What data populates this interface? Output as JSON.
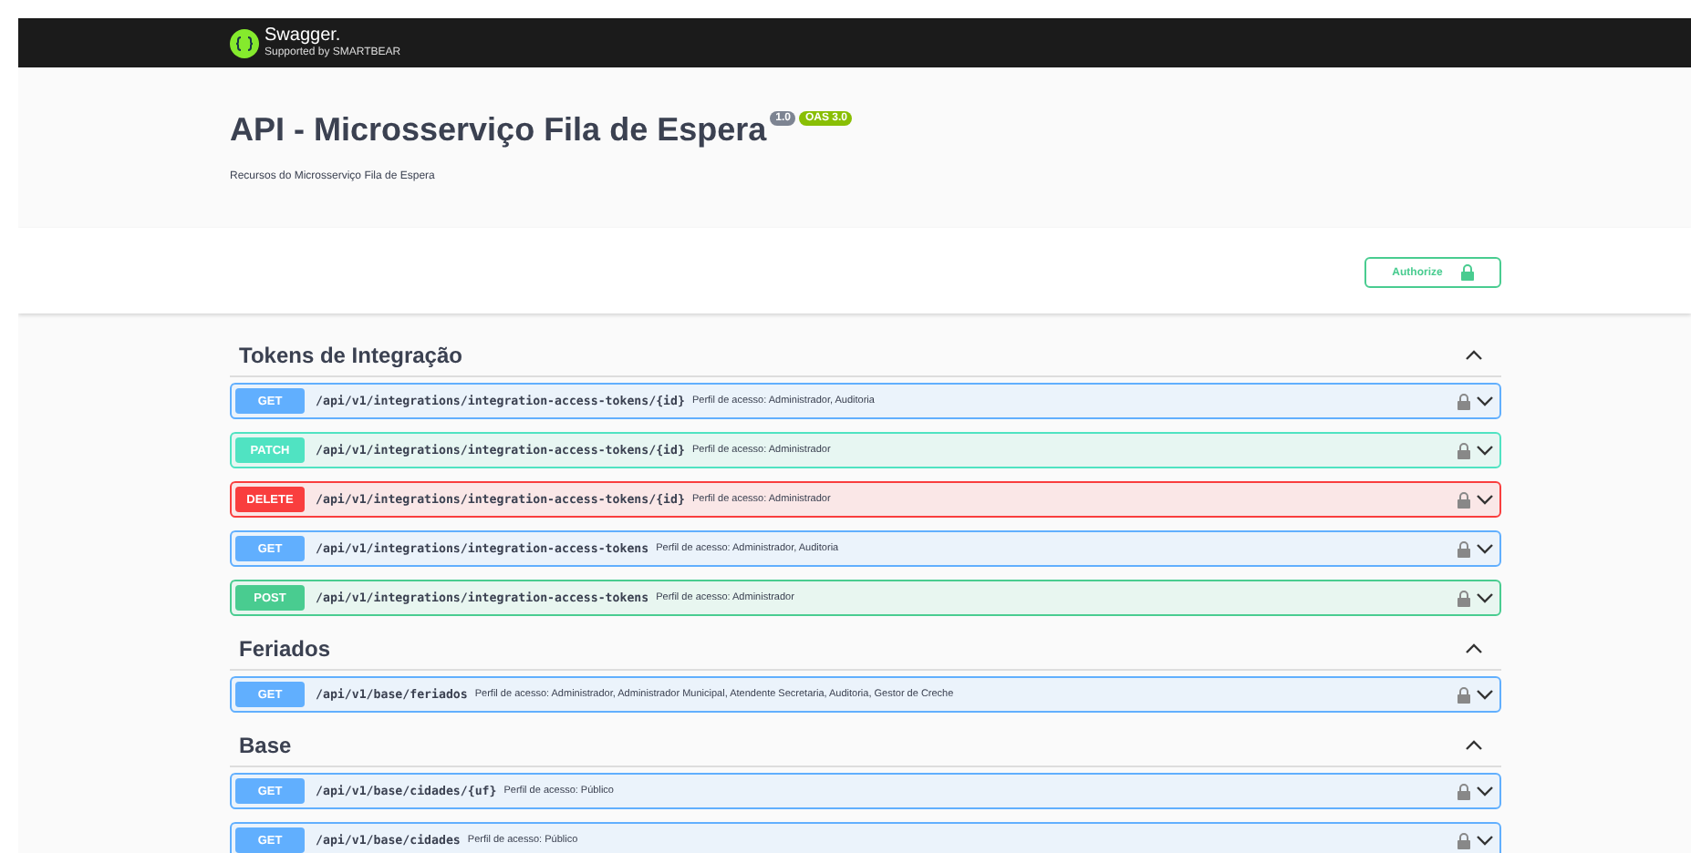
{
  "topbar": {
    "logo_text": "Swagger.",
    "logo_subtext": "Supported by SMARTBEAR"
  },
  "info": {
    "title": "API - Microsserviço Fila de Espera",
    "version": "1.0",
    "oas": "OAS 3.0",
    "description": "Recursos do Microsserviço Fila de Espera"
  },
  "authorize_button": {
    "label": "Authorize"
  },
  "tags": [
    {
      "name": "Tokens de Integração",
      "expanded": true,
      "operations": [
        {
          "kind": "get",
          "method": "GET",
          "path": "/api/v1/integrations/integration-access-tokens/{id}",
          "summary": "Perfil de acesso: Administrador, Auditoria"
        },
        {
          "kind": "patch",
          "method": "PATCH",
          "path": "/api/v1/integrations/integration-access-tokens/{id}",
          "summary": "Perfil de acesso: Administrador"
        },
        {
          "kind": "delete",
          "method": "DELETE",
          "path": "/api/v1/integrations/integration-access-tokens/{id}",
          "summary": "Perfil de acesso: Administrador"
        },
        {
          "kind": "get",
          "method": "GET",
          "path": "/api/v1/integrations/integration-access-tokens",
          "summary": "Perfil de acesso: Administrador, Auditoria"
        },
        {
          "kind": "post",
          "method": "POST",
          "path": "/api/v1/integrations/integration-access-tokens",
          "summary": "Perfil de acesso: Administrador"
        }
      ]
    },
    {
      "name": "Feriados",
      "expanded": true,
      "operations": [
        {
          "kind": "get",
          "method": "GET",
          "path": "/api/v1/base/feriados",
          "summary": "Perfil de acesso: Administrador, Administrador Municipal, Atendente Secretaria, Auditoria, Gestor de Creche"
        }
      ]
    },
    {
      "name": "Base",
      "expanded": true,
      "operations": [
        {
          "kind": "get",
          "method": "GET",
          "path": "/api/v1/base/cidades/{uf}",
          "summary": "Perfil de acesso: Público"
        },
        {
          "kind": "get",
          "method": "GET",
          "path": "/api/v1/base/cidades",
          "summary": "Perfil de acesso: Público"
        }
      ]
    }
  ]
}
